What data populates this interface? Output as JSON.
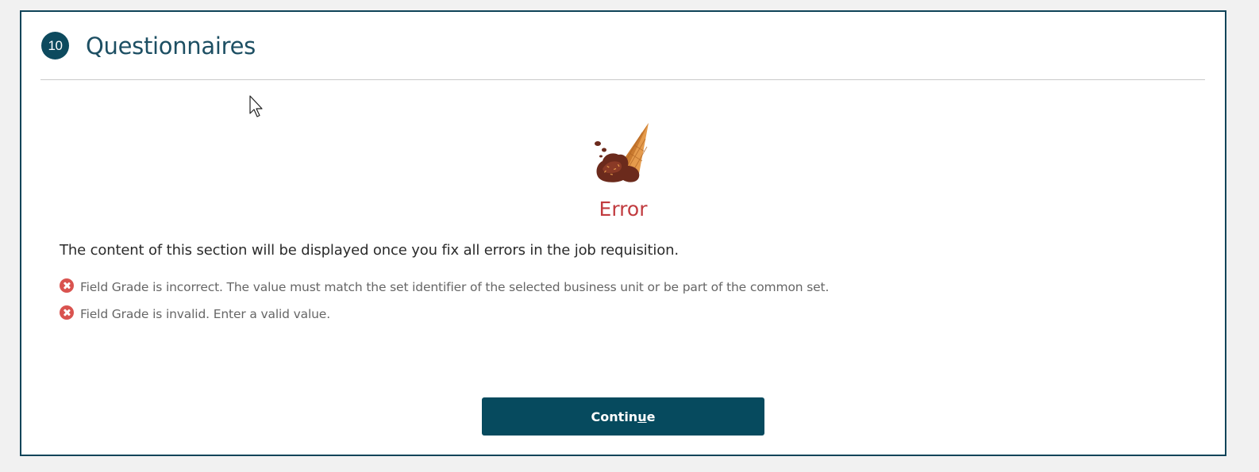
{
  "section": {
    "step_number": "10",
    "title": "Questionnaires"
  },
  "error": {
    "illustration": "dropped-ice-cream-cone",
    "title": "Error",
    "message": "The content of this section will be displayed once you fix all errors in the job requisition.",
    "items": [
      {
        "icon": "error-circle-x-icon",
        "text": "Field Grade is incorrect. The value must match the set identifier of the selected business unit or be part of the common set."
      },
      {
        "icon": "error-circle-x-icon",
        "text": "Field Grade is invalid. Enter a valid value."
      }
    ]
  },
  "actions": {
    "continue_label_start": "Contin",
    "continue_label_access_key": "u",
    "continue_label_end": "e"
  },
  "colors": {
    "accent": "#064a5e",
    "error": "#c13b3f",
    "error_icon": "#d9534f"
  }
}
